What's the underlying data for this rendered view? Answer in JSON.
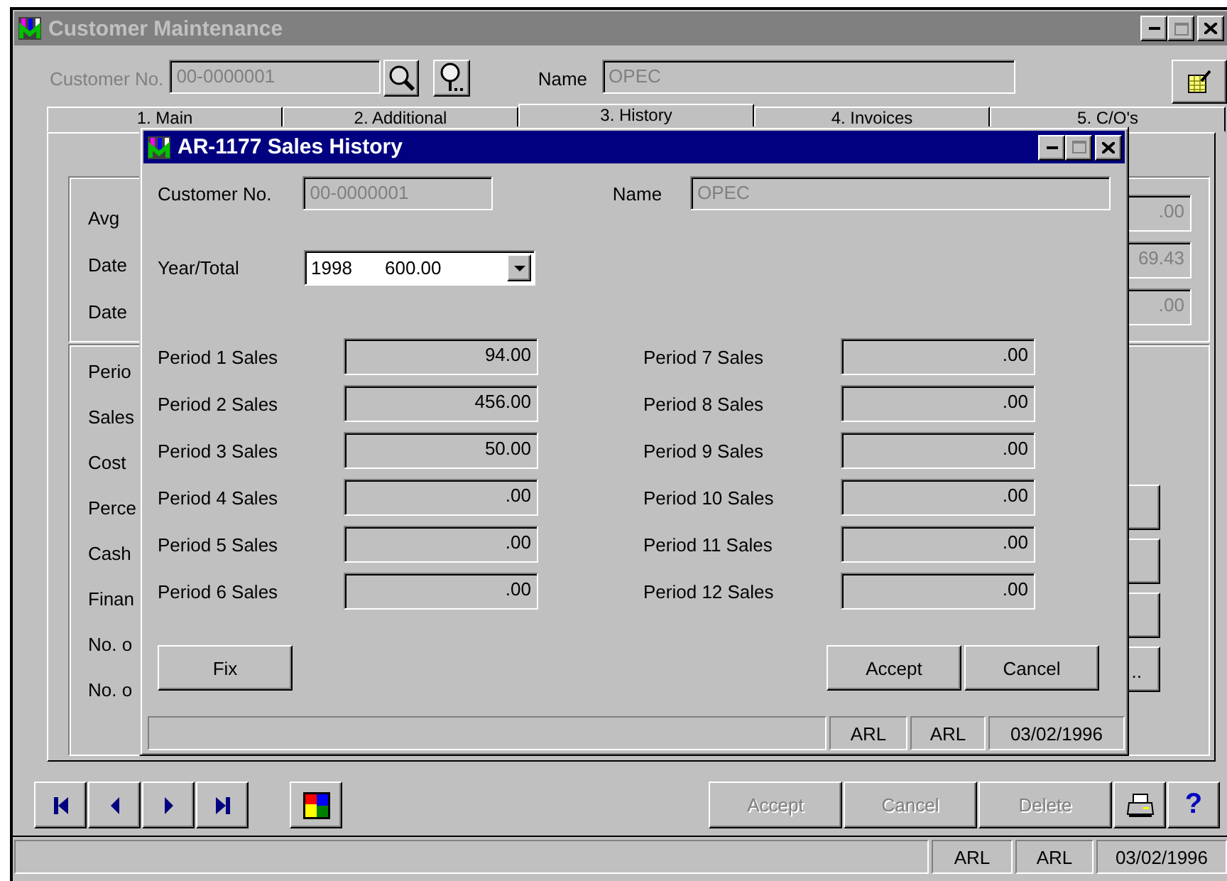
{
  "window": {
    "title": "Customer Maintenance",
    "active": false
  },
  "header": {
    "customer_no_label": {
      "text": "Customer No.",
      "disabled": true
    },
    "customer_no": {
      "value": "00-0000001",
      "disabled": true
    },
    "name_label": {
      "text": "Name",
      "disabled": false
    },
    "name": {
      "value": "OPEC",
      "disabled": true
    }
  },
  "tabs": [
    {
      "label": "1. Main",
      "selected": false
    },
    {
      "label": "2. Additional",
      "selected": false
    },
    {
      "label": "3. History",
      "selected": true
    },
    {
      "label": "4. Invoices",
      "selected": false
    },
    {
      "label": "5. C/O's",
      "selected": false
    }
  ],
  "panel": {
    "summary_labels": [
      "Avg",
      "Date",
      "Date"
    ],
    "summary_fields": [
      {
        "value": ".00",
        "disabled": true
      },
      {
        "value": "69.43",
        "disabled": true
      },
      {
        "value": ".00",
        "disabled": true
      }
    ],
    "period_labels": [
      "Perio",
      "Sales",
      "Cost",
      "Perce",
      "Cash",
      "Finan",
      "No. o",
      "No. o"
    ],
    "side_buttons": [
      {
        "kind": "blank"
      },
      {
        "kind": "blank"
      },
      {
        "kind": "blank"
      },
      {
        "kind": "text",
        "label": ".."
      }
    ]
  },
  "toolbar": {
    "buttons": [
      {
        "label": "Accept",
        "disabled": true
      },
      {
        "label": "Cancel",
        "disabled": true
      },
      {
        "label": "Delete",
        "disabled": true
      }
    ],
    "help": "?"
  },
  "status_bar": [
    "ARL",
    "ARL",
    "03/02/1996"
  ],
  "dialog": {
    "title": "AR-1177 Sales History",
    "active": true,
    "customer_no_label": "Customer No.",
    "customer_no": {
      "value": "00-0000001",
      "disabled": true
    },
    "name_label": "Name",
    "name": {
      "value": "OPEC",
      "disabled": true
    },
    "year_total_label": "Year/Total",
    "year": "1998",
    "total": "600.00",
    "periods": [
      {
        "label": "Period 1 Sales",
        "value": "94.00"
      },
      {
        "label": "Period 2 Sales",
        "value": "456.00"
      },
      {
        "label": "Period 3 Sales",
        "value": "50.00"
      },
      {
        "label": "Period 4 Sales",
        "value": ".00"
      },
      {
        "label": "Period 5 Sales",
        "value": ".00"
      },
      {
        "label": "Period 6 Sales",
        "value": ".00"
      },
      {
        "label": "Period 7 Sales",
        "value": ".00"
      },
      {
        "label": "Period 8 Sales",
        "value": ".00"
      },
      {
        "label": "Period 9 Sales",
        "value": ".00"
      },
      {
        "label": "Period 10 Sales",
        "value": ".00"
      },
      {
        "label": "Period 11 Sales",
        "value": ".00"
      },
      {
        "label": "Period 12 Sales",
        "value": ".00"
      }
    ],
    "buttons": [
      {
        "label": "Fix",
        "disabled": false
      },
      {
        "label": "Accept",
        "disabled": false
      },
      {
        "label": "Cancel",
        "disabled": false
      }
    ],
    "status_bar": [
      "ARL",
      "ARL",
      "03/02/1996"
    ]
  }
}
